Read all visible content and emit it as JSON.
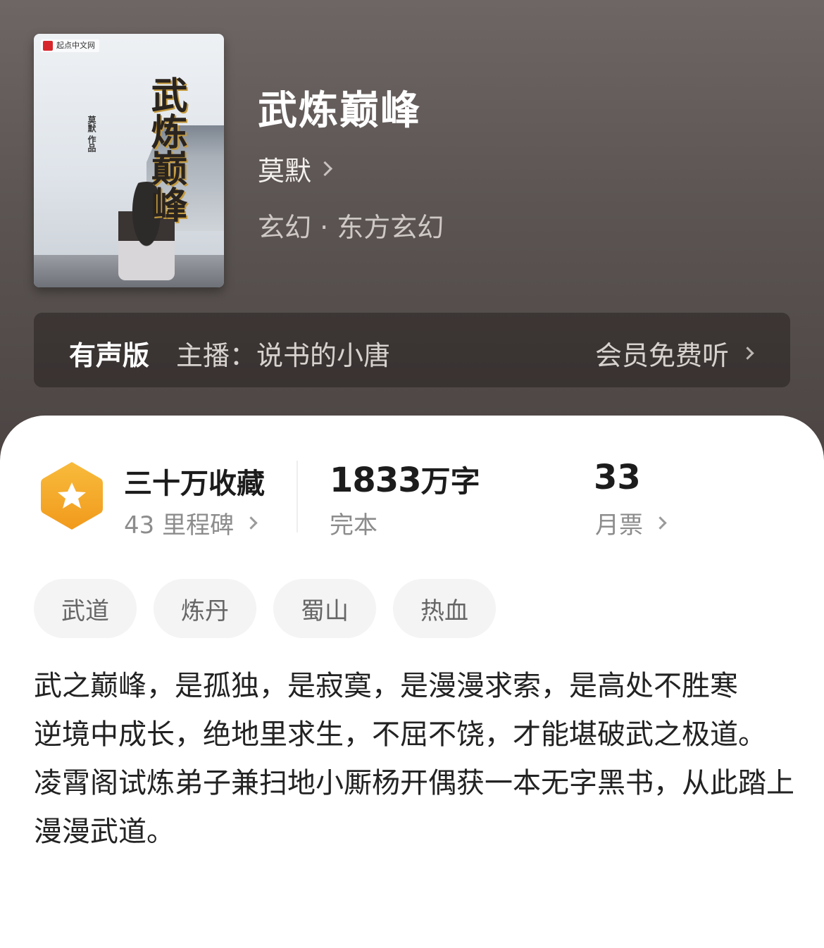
{
  "colors": {
    "header_bg": "#5b5452",
    "panel_bg": "#ffffff",
    "tag_bg": "#f4f4f4",
    "icon_gold": "#f5a623"
  },
  "cover": {
    "publisher": "起点中文网",
    "title_text": "武炼巅峰",
    "author_text": "莫默 作品"
  },
  "book": {
    "title": "武炼巅峰",
    "author": "莫默",
    "genre": "玄幻 · 东方玄幻"
  },
  "audio": {
    "label": "有声版",
    "host": "主播：说书的小唐",
    "action": "会员免费听"
  },
  "stats": {
    "collections": {
      "title": "三十万收藏",
      "sub": "43 里程碑",
      "icon": "star-badge-icon"
    },
    "words": {
      "value": "1833",
      "unit": "万字",
      "sub": "完本"
    },
    "tickets": {
      "value": "33",
      "sub": "月票"
    }
  },
  "tags": [
    "武道",
    "炼丹",
    "蜀山",
    "热血"
  ],
  "synopsis": [
    "武之巅峰，是孤独，是寂寞，是漫漫求索，是高处不胜寒",
    "逆境中成长，绝地里求生，不屈不饶，才能堪破武之极道。",
    "凌霄阁试炼弟子兼扫地小厮杨开偶获一本无字黑书，从此踏上漫漫武道。"
  ]
}
